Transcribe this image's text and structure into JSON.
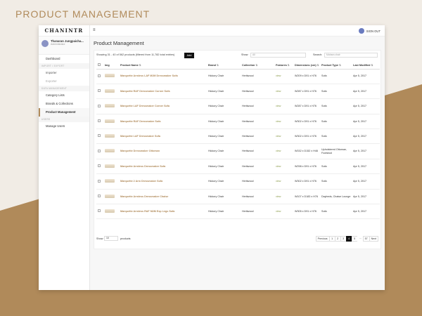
{
  "heading": "PRODUCT MANAGEMENT",
  "colors": {
    "accent": "#b08a5a",
    "background": "#f1ece5",
    "band": "#b08a5a",
    "button": "#111111",
    "view_link": "#8a9b4a"
  },
  "app": {
    "logo": "CHANINTR",
    "signout": "SIGN OUT"
  },
  "user": {
    "name": "Thanaran Jungpaicha...",
    "role": "Administrator"
  },
  "sidebar": {
    "items": [
      {
        "label": "Dashboard",
        "type": "item"
      },
      {
        "label": "IMPORT / EXPORT",
        "type": "section"
      },
      {
        "label": "Importer",
        "type": "sub"
      },
      {
        "label": "Exporter",
        "type": "muted"
      },
      {
        "label": "DATA MANAGEMENT",
        "type": "section"
      },
      {
        "label": "Category Lists",
        "type": "item"
      },
      {
        "label": "Brands & Collections",
        "type": "item"
      },
      {
        "label": "Product Management",
        "type": "active"
      },
      {
        "label": "USERS",
        "type": "section"
      },
      {
        "label": "Manage Users",
        "type": "item"
      }
    ]
  },
  "main": {
    "title": "Product Management",
    "showing": "Showing 31 - 40 of 562 products (filtered from 11,782 total entries)",
    "add_label": "Add",
    "show_label": "Show",
    "show_value": "All",
    "search_label": "Search:",
    "search_placeholder": "Mahara chair"
  },
  "table": {
    "columns": [
      "",
      "Img",
      "Product Name",
      "Brand",
      "Collection",
      "Features",
      "Dimensions (cm)",
      "Product Type",
      "Last Modified"
    ],
    "rows": [
      {
        "name": "Marquette Armless LAF M2M Dressmaker Sofa",
        "brand": "Hickory Chair",
        "collection": "Heritwood",
        "features": "view",
        "dims": "W209 x D91 x H76",
        "type": "Sofa",
        "modified": "Apr 5, 2017"
      },
      {
        "name": "Marquette RAF Dressmaker Corner Sofa",
        "brand": "Hickory Chair",
        "collection": "Heritwood",
        "features": "view",
        "dims": "W287 x D91 x H76",
        "type": "Sofa",
        "modified": "Apr 5, 2017"
      },
      {
        "name": "Marquette LAF Dressmaker Corner Sofa",
        "brand": "Hickory Chair",
        "collection": "Heritwood",
        "features": "view",
        "dims": "W287 x D91 x H76",
        "type": "Sofa",
        "modified": "Apr 5, 2017"
      },
      {
        "name": "Marquette RAF Dressmaker Sofa",
        "brand": "Hickory Chair",
        "collection": "Heritwood",
        "features": "view",
        "dims": "W302 x D91 x H76",
        "type": "Sofa",
        "modified": "Apr 5, 2017"
      },
      {
        "name": "Marquette LAF Dressmaker Sofa",
        "brand": "Hickory Chair",
        "collection": "Heritwood",
        "features": "view",
        "dims": "W302 x D91 x H76",
        "type": "Sofa",
        "modified": "Apr 5, 2017"
      },
      {
        "name": "Marquette Dressmaker Ottoman",
        "brand": "Hickory Chair",
        "collection": "Heritwood",
        "features": "view",
        "dims": "W152 x D152 x H46",
        "type": "Upholstered Ottoman, Footstool",
        "modified": "Apr 5, 2017"
      },
      {
        "name": "Marquette Armless Dressmaker Sofa",
        "brand": "Hickory Chair",
        "collection": "Heritwood",
        "features": "view",
        "dims": "W298 x D91 x H76",
        "type": "Sofa",
        "modified": "Apr 5, 2017"
      },
      {
        "name": "Marquette 2 Arm Dressmaker Sofa",
        "brand": "Hickory Chair",
        "collection": "Heritwood",
        "features": "view",
        "dims": "W302 x D91 x H76",
        "type": "Sofa",
        "modified": "Apr 5, 2017"
      },
      {
        "name": "Marquette Armless Dressmaker Chaise",
        "brand": "Hickory Chair",
        "collection": "Heritwood",
        "features": "view",
        "dims": "W107 x D183 x H76",
        "type": "Daybeds, Chaise Lounge",
        "modified": "Apr 5, 2017"
      },
      {
        "name": "Marquette Armless RAF M2M Exp Legs Sofa",
        "brand": "Hickory Chair",
        "collection": "Heritwood",
        "features": "view",
        "dims": "W305 x D91 x H76",
        "type": "Sofa",
        "modified": "Apr 5, 2017"
      }
    ]
  },
  "footer": {
    "show_label": "Show",
    "show_value": "10",
    "products_label": "products",
    "pages": [
      "Previous",
      "1",
      "2",
      "3",
      "4",
      "5",
      "...",
      "57",
      "Next"
    ],
    "active_page": "4"
  }
}
